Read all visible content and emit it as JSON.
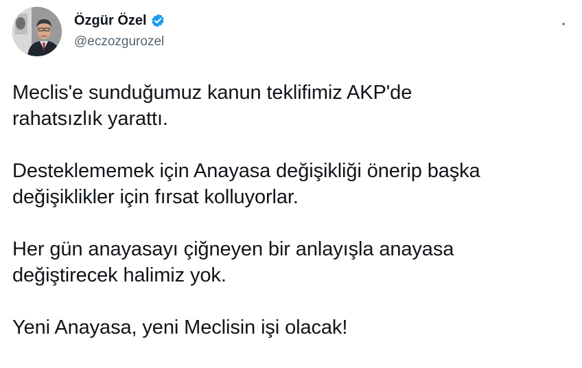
{
  "author": {
    "display_name": "Özgür Özel",
    "handle": "@eczozgurozel",
    "verified": true,
    "verified_color": "#1d9bf0",
    "avatar_icon": "profile-photo"
  },
  "more_icon": "ellipsis-icon",
  "tweet": {
    "paragraphs": [
      {
        "lines": [
          "Meclis'e sunduğumuz kanun teklifimiz AKP'de",
          "rahatsızlık yarattı."
        ]
      },
      {
        "lines": [
          "Desteklememek için Anayasa değişikliği önerip başka",
          "değişiklikler için fırsat kolluyorlar."
        ]
      },
      {
        "lines": [
          "Her gün anayasayı çiğneyen bir anlayışla anayasa",
          "değiştirecek halimiz yok."
        ]
      },
      {
        "lines": [
          "Yeni Anayasa, yeni Meclisin işi olacak!"
        ]
      }
    ]
  },
  "colors": {
    "text": "#0f1419",
    "secondary": "#536471"
  }
}
